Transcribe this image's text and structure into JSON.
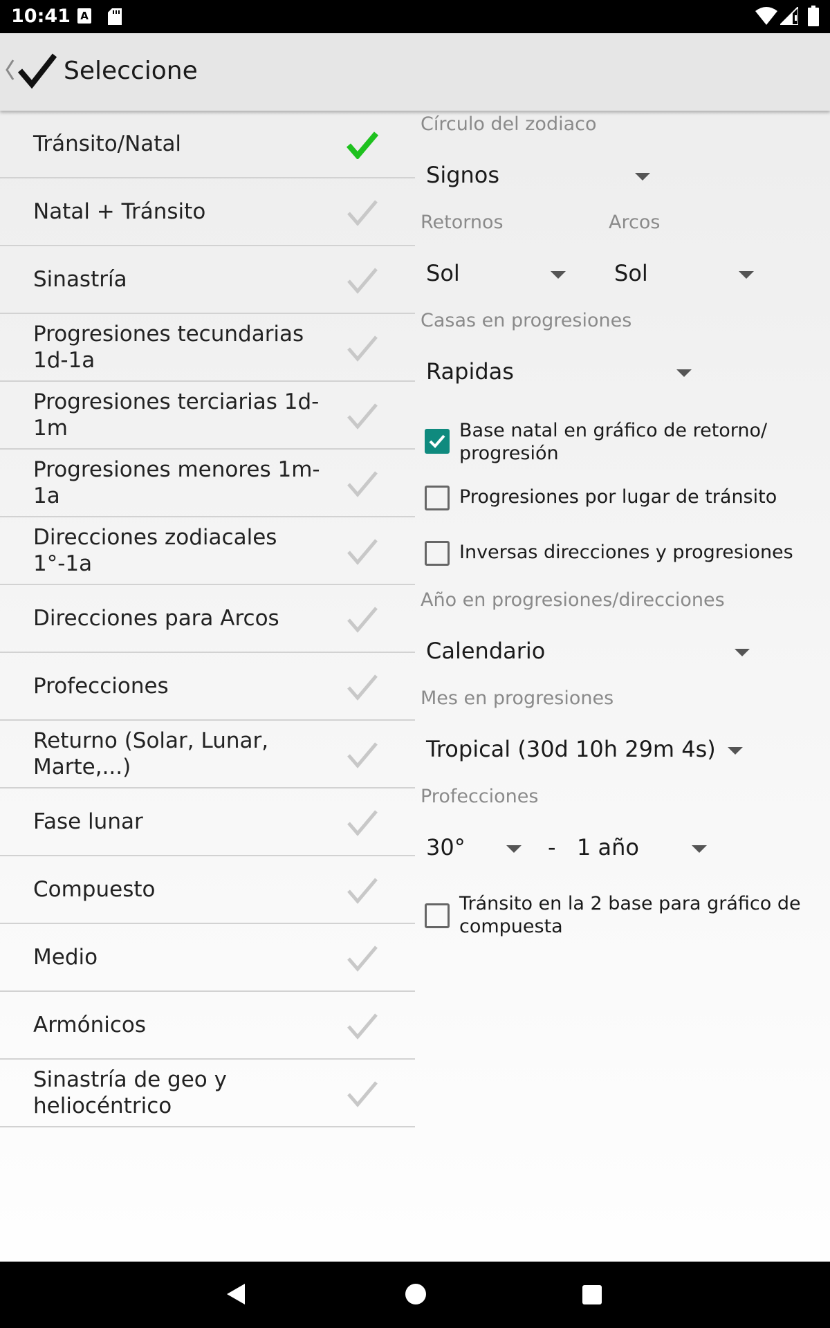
{
  "status_bar": {
    "time": "10:41",
    "icons": [
      "notification-a-icon",
      "sd-card-icon",
      "wifi-icon",
      "signal-icon",
      "battery-icon"
    ]
  },
  "app_bar": {
    "title": "Seleccione",
    "icons": [
      "back-chevron-icon",
      "checkmark-icon"
    ]
  },
  "chart_types": [
    {
      "label": "Tránsito/Natal",
      "selected": true
    },
    {
      "label": "Natal + Tránsito",
      "selected": false
    },
    {
      "label": "Sinastría",
      "selected": false
    },
    {
      "label": "Progresiones tecundarias 1d-1a",
      "selected": false
    },
    {
      "label": "Progresiones terciarias 1d-1m",
      "selected": false
    },
    {
      "label": "Progresiones menores 1m-1a",
      "selected": false
    },
    {
      "label": "Direcciones zodiacales 1°-1a",
      "selected": false
    },
    {
      "label": "Direcciones para Arcos",
      "selected": false
    },
    {
      "label": "Profecciones",
      "selected": false
    },
    {
      "label": "Returno (Solar, Lunar, Marte,...)",
      "selected": false
    },
    {
      "label": "Fase lunar",
      "selected": false
    },
    {
      "label": "Compuesto",
      "selected": false
    },
    {
      "label": "Medio",
      "selected": false
    },
    {
      "label": "Armónicos",
      "selected": false
    },
    {
      "label": "Sinastría de geo y heliocéntrico",
      "selected": false
    }
  ],
  "settings": {
    "zodiac": {
      "label": "Círculo del zodiaco",
      "value": "Signos"
    },
    "returns": {
      "label": "Retornos",
      "value": "Sol"
    },
    "arcs": {
      "label": "Arcos",
      "value": "Sol"
    },
    "houses": {
      "label": "Casas en progresiones",
      "value": "Rapidas"
    },
    "cb_natal_base": {
      "label": "Base natal en gráfico de retorno/ progresión",
      "checked": true
    },
    "cb_transit_place": {
      "label": "Progresiones por lugar de tránsito",
      "checked": false
    },
    "cb_inverse": {
      "label": "Inversas direcciones y progresiones",
      "checked": false
    },
    "year": {
      "label": "Año en progresiones/direcciones",
      "value": "Calendario"
    },
    "month": {
      "label": "Mes en progresiones",
      "value": "Tropical (30d 10h 29m 4s)"
    },
    "profections": {
      "label": "Profecciones",
      "degree_value": "30°",
      "separator": "-",
      "period_value": "1 año"
    },
    "cb_transit_composite": {
      "label": "Tránsito en la 2 base para gráfico de compuesta",
      "checked": false
    }
  },
  "colors": {
    "selected_check": "#1ec11e",
    "unselected_check": "#c8c8c8",
    "checkbox_accent": "#0f8a7e"
  }
}
